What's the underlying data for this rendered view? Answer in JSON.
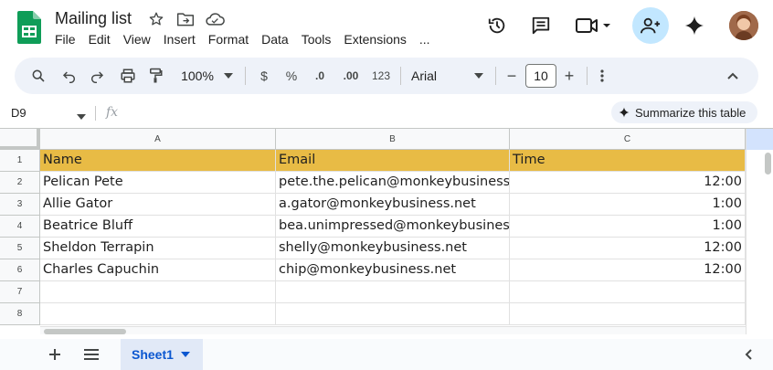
{
  "app": {
    "doc_title": "Mailing list",
    "menu": [
      "File",
      "Edit",
      "View",
      "Insert",
      "Format",
      "Data",
      "Tools",
      "Extensions",
      "..."
    ]
  },
  "toolbar": {
    "zoom": "100%",
    "currency": "$",
    "percent": "%",
    "decrease_decimals": ".0",
    "increase_decimals": ".00",
    "number_format": "123",
    "font": "Arial",
    "font_size": "10",
    "minus": "−",
    "plus": "+"
  },
  "formula_bar": {
    "cell_ref": "D9",
    "fx": "fx",
    "summarize_label": "Summarize this table"
  },
  "grid": {
    "columns": [
      "A",
      "B",
      "C"
    ],
    "rows": [
      "1",
      "2",
      "3",
      "4",
      "5",
      "6",
      "7",
      "8"
    ],
    "header": [
      "Name",
      "Email",
      "Time"
    ],
    "data": [
      [
        "Pelican Pete",
        "pete.the.pelican@monkeybusiness.net",
        "12:00"
      ],
      [
        "Allie Gator",
        "a.gator@monkeybusiness.net",
        "1:00"
      ],
      [
        "Beatrice Bluff",
        "bea.unimpressed@monkeybusiness.net",
        "1:00"
      ],
      [
        "Sheldon Terrapin",
        "shelly@monkeybusiness.net",
        "12:00"
      ],
      [
        "Charles Capuchin",
        "chip@monkeybusiness.net",
        "12:00"
      ]
    ]
  },
  "sheets": {
    "active": "Sheet1"
  },
  "colors": {
    "header_fill": "#e8bb45",
    "accent": "#0b57d0",
    "share_bg": "#c2e7ff"
  },
  "icons": [
    "sheets-logo-icon",
    "star-icon",
    "move-folder-icon",
    "cloud-status-icon",
    "history-icon",
    "comment-icon",
    "meet-icon",
    "share-person-add-icon",
    "gemini-icon",
    "search-icon",
    "undo-icon",
    "redo-icon",
    "print-icon",
    "paint-format-icon",
    "more-vert-icon",
    "collapse-icon",
    "sheet-list-icon",
    "add-sheet-icon"
  ]
}
